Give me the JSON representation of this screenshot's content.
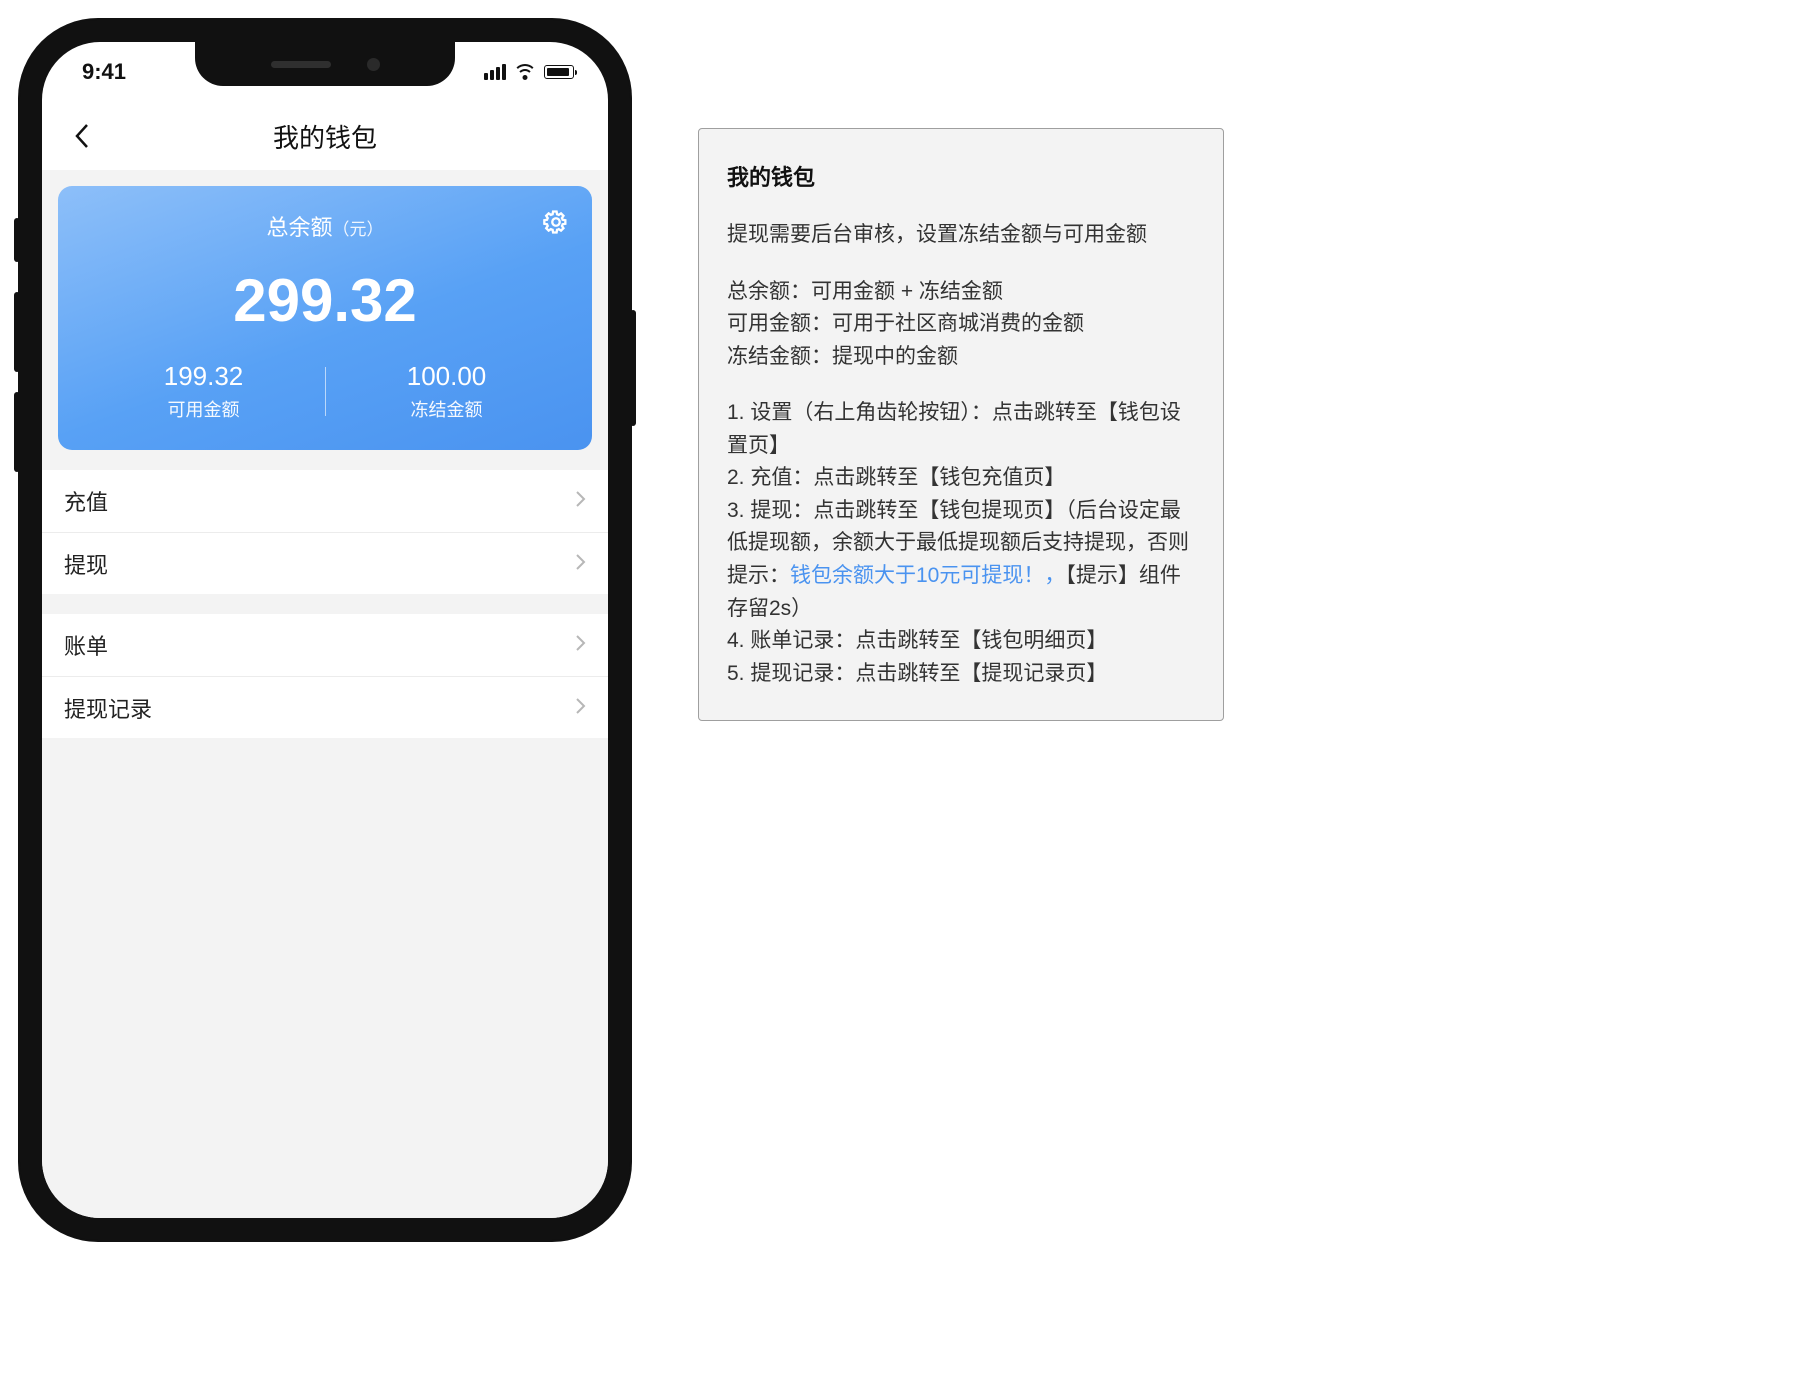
{
  "status": {
    "time": "9:41"
  },
  "nav": {
    "title": "我的钱包"
  },
  "card": {
    "title_main": "总余额",
    "title_unit": "（元）",
    "total": "299.32",
    "available": {
      "value": "199.32",
      "label": "可用金额"
    },
    "frozen": {
      "value": "100.00",
      "label": "冻结金额"
    }
  },
  "rows": {
    "recharge": "充值",
    "withdraw": "提现",
    "bill": "账单",
    "withdrawLog": "提现记录"
  },
  "anno": {
    "title": "我的钱包",
    "intro": "提现需要后台审核，设置冻结金额与可用金额",
    "def1": "总余额：可用金额 + 冻结金额",
    "def2": "可用金额：可用于社区商城消费的金额",
    "def3": "冻结金额：提现中的金额",
    "n1": "1. 设置（右上角齿轮按钮）：点击跳转至【钱包设置页】",
    "n2": "2. 充值：点击跳转至【钱包充值页】",
    "n3a": "3. 提现：点击跳转至【钱包提现页】（后台设定最低提现额，余额大于最低提现额后支持提现，否则提示：",
    "n3tip": "钱包余额大于10元可提现！，",
    "n3b": "【提示】组件存留2s）",
    "n4": "4. 账单记录：点击跳转至【钱包明细页】",
    "n5": "5. 提现记录：点击跳转至【提现记录页】"
  }
}
